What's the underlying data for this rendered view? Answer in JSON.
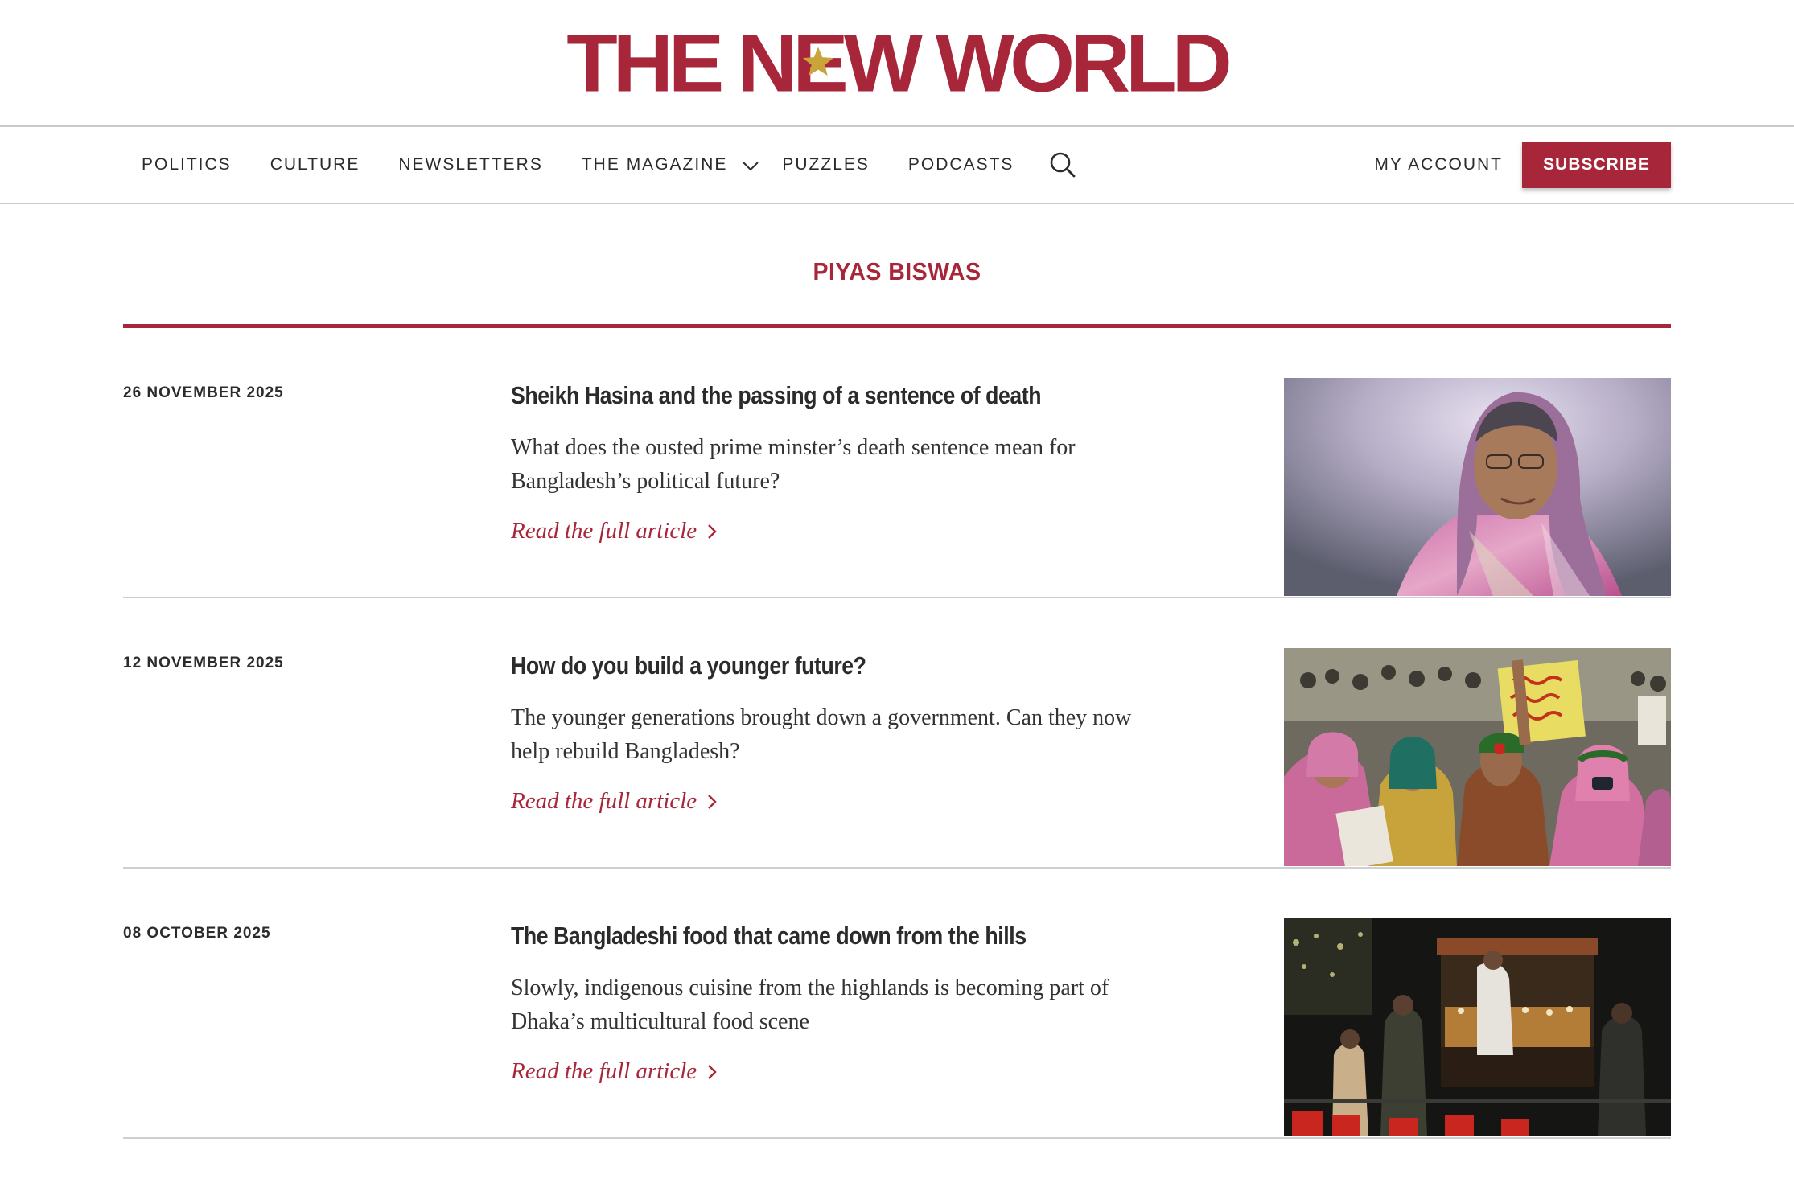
{
  "brand": {
    "logo_part1": "THE",
    "logo_part2_pre": "N",
    "logo_part2_e": "E",
    "logo_part2_post": "W",
    "logo_part3": "WORLD",
    "brand_color": "#a8263a",
    "star_color": "#c9a43a"
  },
  "nav": {
    "items": [
      "POLITICS",
      "CULTURE",
      "NEWSLETTERS",
      "THE MAGAZINE",
      "PUZZLES",
      "PODCASTS"
    ],
    "account_label": "MY ACCOUNT",
    "subscribe_label": "SUBSCRIBE"
  },
  "author": {
    "name": "PIYAS BISWAS"
  },
  "articles": [
    {
      "date": "26 NOVEMBER 2025",
      "title": "Sheikh Hasina and the passing of a sentence of death",
      "desc": "What does the ousted prime minster’s death sentence mean for Bangladesh’s political future?",
      "link_label": "Read the full article",
      "image_icon": "portrait-photo"
    },
    {
      "date": "12 NOVEMBER 2025",
      "title": "How do you build a younger future?",
      "desc": "The younger generations brought down a government. Can they now help rebuild Bangladesh?",
      "link_label": "Read the full article",
      "image_icon": "protest-photo"
    },
    {
      "date": "08 OCTOBER 2025",
      "title": "The Bangladeshi food that came down from the hills",
      "desc": "Slowly, indigenous cuisine from the highlands is becoming part of Dhaka’s multicultural food scene",
      "link_label": "Read the full article",
      "image_icon": "night-food-stall-photo"
    }
  ]
}
